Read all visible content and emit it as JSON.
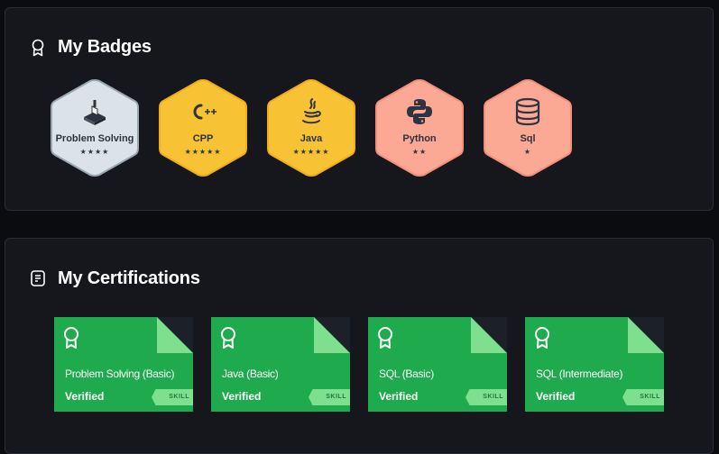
{
  "badges_section": {
    "title": "My Badges",
    "items": [
      {
        "name": "Problem Solving",
        "stars": "★★★★",
        "icon": "problem-solving-icon",
        "fill": "#dce3e8",
        "stroke": "#9aa6b0"
      },
      {
        "name": "CPP",
        "stars": "★★★★★",
        "icon": "cpp-icon",
        "fill": "#f7c234",
        "stroke": "#f0ad1c"
      },
      {
        "name": "Java",
        "stars": "★★★★★",
        "icon": "java-icon",
        "fill": "#f7c234",
        "stroke": "#f0ad1c"
      },
      {
        "name": "Python",
        "stars": "★★",
        "icon": "python-icon",
        "fill": "#fba894",
        "stroke": "#f58e78"
      },
      {
        "name": "Sql",
        "stars": "★",
        "icon": "database-icon",
        "fill": "#fba894",
        "stroke": "#f58e78"
      }
    ]
  },
  "certifications_section": {
    "title": "My Certifications",
    "items": [
      {
        "name": "Problem Solving (Basic)",
        "status": "Verified",
        "tag": "SKILL"
      },
      {
        "name": "Java (Basic)",
        "status": "Verified",
        "tag": "SKILL"
      },
      {
        "name": "SQL (Basic)",
        "status": "Verified",
        "tag": "SKILL"
      },
      {
        "name": "SQL (Intermediate)",
        "status": "Verified",
        "tag": "SKILL"
      }
    ]
  },
  "colors": {
    "page_bg": "#0b0c10",
    "panel_bg": "#15171d",
    "cert_green": "#1fab4d",
    "cert_light": "#7ee08e"
  }
}
